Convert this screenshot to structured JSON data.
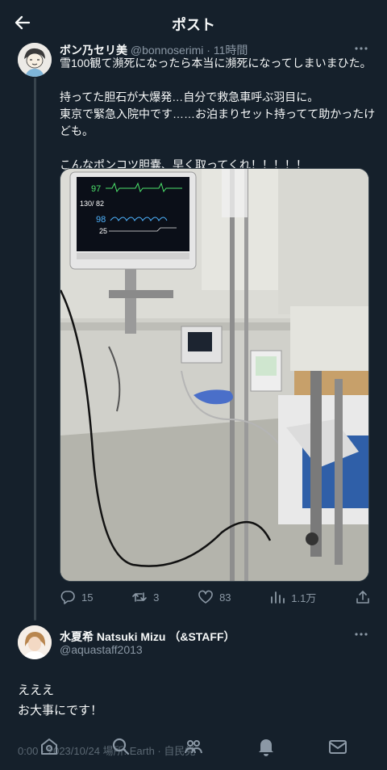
{
  "header": {
    "title": "ポスト",
    "back_icon": "arrow-left-icon"
  },
  "tweet": {
    "author_name": "ボン乃セリ美",
    "author_handle": "@bonnoserimi",
    "time": "· 11時間",
    "lines": [
      "雪100観て瀕死になったら本当に瀕死になってしまいまひた。",
      "",
      "持ってた胆石が大爆発…自分で救急車呼ぶ羽目に。",
      "東京で緊急入院中です……お泊まりセット持ってて助かったけ",
      "ども。",
      "",
      "こんなポンコツ胆嚢、早く取ってくれ！！！！！"
    ],
    "monitor": {
      "hr": "97",
      "bp": "130/ 82",
      "spo2": "98",
      "rr": "25"
    },
    "actions": {
      "replies": "15",
      "retweets": "3",
      "likes": "83",
      "views": "1.1万"
    }
  },
  "reply": {
    "author_name": "水夏希 Natsuki Mizu （&STAFF）",
    "author_handle": "@aquastaff2013",
    "line1": "えええ",
    "line2": "お大事にです！"
  },
  "meta": {
    "text": "0:00 · 2023/10/24 場所: Earth · 自民党"
  },
  "nav": [
    "home-icon",
    "search-icon",
    "communities-icon",
    "notifications-icon",
    "messages-icon"
  ],
  "colors": {
    "background": "#15202b",
    "text": "#f7f9f9",
    "muted": "#8b98a5",
    "divider": "#38444d"
  }
}
